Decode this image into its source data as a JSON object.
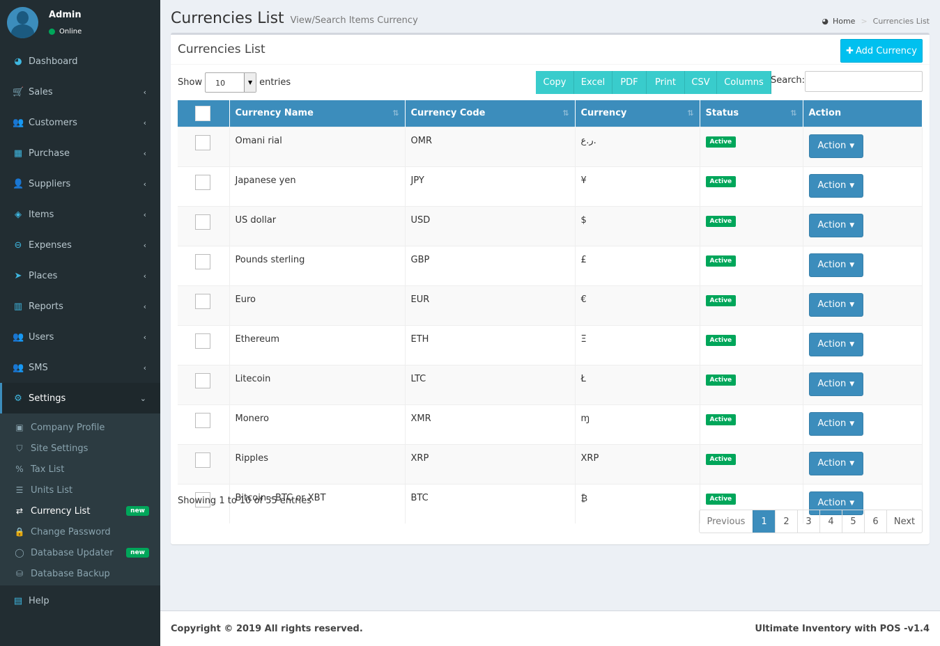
{
  "user": {
    "name": "Admin",
    "status": "Online"
  },
  "menu": [
    {
      "label": "Dashboard",
      "icon": "tachometer-icon",
      "glyph": "◕",
      "chevron": ""
    },
    {
      "label": "Sales",
      "icon": "cart-icon",
      "glyph": "🛒",
      "chevron": "‹"
    },
    {
      "label": "Customers",
      "icon": "users-icon",
      "glyph": "👥",
      "chevron": "‹"
    },
    {
      "label": "Purchase",
      "icon": "grid-icon",
      "glyph": "▦",
      "chevron": "‹"
    },
    {
      "label": "Suppliers",
      "icon": "user-plus-icon",
      "glyph": "👤",
      "chevron": "‹"
    },
    {
      "label": "Items",
      "icon": "cubes-icon",
      "glyph": "◈",
      "chevron": "‹"
    },
    {
      "label": "Expenses",
      "icon": "minus-circle-icon",
      "glyph": "⊖",
      "chevron": "‹"
    },
    {
      "label": "Places",
      "icon": "paper-plane-icon",
      "glyph": "➤",
      "chevron": "‹"
    },
    {
      "label": "Reports",
      "icon": "bar-chart-icon",
      "glyph": "▥",
      "chevron": "‹"
    },
    {
      "label": "Users",
      "icon": "users-icon",
      "glyph": "👥",
      "chevron": "‹"
    },
    {
      "label": "SMS",
      "icon": "users-icon",
      "glyph": "👥",
      "chevron": "‹"
    },
    {
      "label": "Settings",
      "icon": "cogs-icon",
      "glyph": "⚙",
      "chevron": "⌄"
    }
  ],
  "settings_sub": [
    {
      "label": "Company Profile",
      "icon": "briefcase-icon",
      "glyph": "▣",
      "badge": ""
    },
    {
      "label": "Site Settings",
      "icon": "shield-icon",
      "glyph": "⛉",
      "badge": ""
    },
    {
      "label": "Tax List",
      "icon": "percent-icon",
      "glyph": "%",
      "badge": ""
    },
    {
      "label": "Units List",
      "icon": "list-icon",
      "glyph": "☰",
      "badge": ""
    },
    {
      "label": "Currency List",
      "icon": "exchange-icon",
      "glyph": "⇄",
      "badge": "new"
    },
    {
      "label": "Change Password",
      "icon": "lock-icon",
      "glyph": "🔒",
      "badge": ""
    },
    {
      "label": "Database Updater",
      "icon": "circle-o-notch-icon",
      "glyph": "◯",
      "badge": "new"
    },
    {
      "label": "Database Backup",
      "icon": "database-icon",
      "glyph": "⛁",
      "badge": ""
    }
  ],
  "help": {
    "label": "Help",
    "icon": "book-icon",
    "glyph": "▤"
  },
  "header": {
    "title": "Currencies List",
    "subtitle": "View/Search Items Currency"
  },
  "breadcrumb": {
    "home": "Home",
    "current": "Currencies List"
  },
  "box": {
    "title": "Currencies List",
    "add_label": "Add Currency"
  },
  "controls": {
    "show": "Show",
    "entries_value": "10",
    "entries": "entries",
    "search": "Search:",
    "exports": [
      "Copy",
      "Excel",
      "PDF",
      "Print",
      "CSV",
      "Columns"
    ]
  },
  "table": {
    "headers": [
      "Currency Name",
      "Currency Code",
      "Currency",
      "Status",
      "Action"
    ],
    "rows": [
      {
        "name": "Omani rial",
        "code": "OMR",
        "symbol": "ر.ع.",
        "status": "Active",
        "action": "Action"
      },
      {
        "name": "Japanese yen",
        "code": "JPY",
        "symbol": "¥",
        "status": "Active",
        "action": "Action"
      },
      {
        "name": "US dollar",
        "code": "USD",
        "symbol": "$",
        "status": "Active",
        "action": "Action"
      },
      {
        "name": "Pounds sterling",
        "code": "GBP",
        "symbol": "£",
        "status": "Active",
        "action": "Action"
      },
      {
        "name": "Euro",
        "code": "EUR",
        "symbol": "€",
        "status": "Active",
        "action": "Action"
      },
      {
        "name": "Ethereum",
        "code": "ETH",
        "symbol": "Ξ",
        "status": "Active",
        "action": "Action"
      },
      {
        "name": "Litecoin",
        "code": "LTC",
        "symbol": "Ł",
        "status": "Active",
        "action": "Action"
      },
      {
        "name": "Monero",
        "code": "XMR",
        "symbol": "ɱ",
        "status": "Active",
        "action": "Action"
      },
      {
        "name": "Ripples",
        "code": "XRP",
        "symbol": "XRP",
        "status": "Active",
        "action": "Action"
      },
      {
        "name": "Bitcoin - BTC or XBT",
        "code": "BTC",
        "symbol": "₿",
        "status": "Active",
        "action": "Action"
      }
    ]
  },
  "info": "Showing 1 to 10 of 55 entries",
  "pagination": [
    "Previous",
    "1",
    "2",
    "3",
    "4",
    "5",
    "6",
    "Next"
  ],
  "pagination_active": "1",
  "footer": {
    "copyright": "Copyright © 2019 All rights reserved.",
    "version": "Ultimate Inventory with POS -v1.4"
  }
}
